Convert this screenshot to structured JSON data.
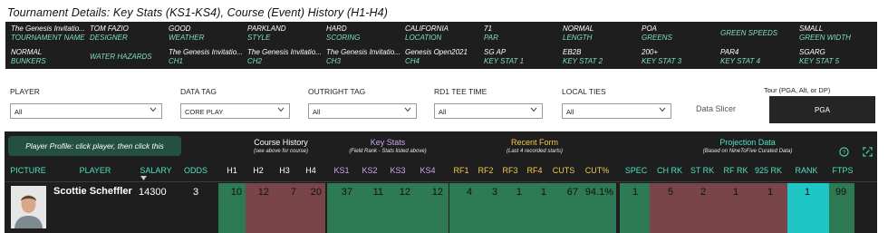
{
  "page_title": "Tournament Details: Key Stats (KS1-KS4), Course (Event) History (H1-H4)",
  "info_grid": [
    {
      "value": "The Genesis Invitatio...",
      "key": "TOURNAMENT NAME"
    },
    {
      "value": "TOM FAZIO",
      "key": "DESIGNER"
    },
    {
      "value": "GOOD",
      "key": "WEATHER"
    },
    {
      "value": "PARKLAND",
      "key": "STYLE"
    },
    {
      "value": "HARD",
      "key": "SCORING"
    },
    {
      "value": "CALIFORNIA",
      "key": "LOCATION"
    },
    {
      "value": "71",
      "key": "PAR"
    },
    {
      "value": "NORMAL",
      "key": "LENGTH"
    },
    {
      "value": "POA",
      "key": "GREENS"
    },
    {
      "value": "",
      "key": "GREEN SPEEDS"
    },
    {
      "value": "SMALL",
      "key": "GREEN WIDTH"
    },
    {
      "value": "NORMAL",
      "key": "BUNKERS"
    },
    {
      "value": "",
      "key": "WATER HAZARDS"
    },
    {
      "value": "The Genesis Invitatio...",
      "key": "CH1"
    },
    {
      "value": "The Genesis Invitatio...",
      "key": "CH2"
    },
    {
      "value": "The Genesis Invitatio...",
      "key": "CH3"
    },
    {
      "value": "Genesis Open2021",
      "key": "CH4"
    },
    {
      "value": "SG AP",
      "key": "KEY STAT 1"
    },
    {
      "value": "EB2B",
      "key": "KEY STAT 2"
    },
    {
      "value": "200+",
      "key": "KEY STAT 3"
    },
    {
      "value": "PAR4",
      "key": "KEY STAT 4"
    },
    {
      "value": "SGARG",
      "key": "KEY STAT 5"
    }
  ],
  "filters": {
    "player": {
      "label": "PLAYER",
      "value": "All"
    },
    "data_tag": {
      "label": "DATA TAG",
      "value": "CORE PLAY"
    },
    "outright_tag": {
      "label": "OUTRIGHT TAG",
      "value": "All"
    },
    "rd1_tee_time": {
      "label": "RD1 TEE TIME",
      "value": "All"
    },
    "local_ties": {
      "label": "LOCAL TIES",
      "value": "All"
    }
  },
  "data_slicer_label": "Data Slicer",
  "tour": {
    "label": "Tour (PGA, Alt, or DP)",
    "value": "PGA"
  },
  "table": {
    "profile_button": "Player Profile: click player, then click this",
    "groups": {
      "course_history": {
        "title": "Course History",
        "sub": "(see above for course)"
      },
      "key_stats": {
        "title": "Key Stats",
        "sub": "(Field Rank - Stats listed above)"
      },
      "recent_form": {
        "title": "Recent Form",
        "sub": "(Last 4 recorded starts)"
      },
      "projection": {
        "title": "Projection Data",
        "sub": "(Based on NineToFive Curated Data)"
      }
    },
    "headers": {
      "picture": "PICTURE",
      "player": "PLAYER",
      "salary": "SALARY",
      "odds": "ODDS",
      "h1": "H1",
      "h2": "H2",
      "h3": "H3",
      "h4": "H4",
      "ks1": "KS1",
      "ks2": "KS2",
      "ks3": "KS3",
      "ks4": "KS4",
      "rf1": "RF1",
      "rf2": "RF2",
      "rf3": "RF3",
      "rf4": "RF4",
      "cuts": "CUTS",
      "cut_pct": "CUT%",
      "spec": "SPEC",
      "ch_rk": "CH RK",
      "st_rk": "ST RK",
      "rf_rk": "RF RK",
      "rk925": "925 RK",
      "rank": "RANK",
      "ftps": "FTPS"
    },
    "row": {
      "player": "Scottie Scheffler",
      "salary": "14300",
      "odds": "3",
      "h1": "10",
      "h2": "12",
      "h3": "7",
      "h4": "20",
      "ks1": "37",
      "ks2": "11",
      "ks3": "12",
      "ks4": "12",
      "rf1": "4",
      "rf2": "3",
      "rf3": "1",
      "rf4": "1",
      "cuts": "67",
      "cut_pct": "94.1%",
      "spec": "1",
      "ch_rk": "5",
      "st_rk": "2",
      "rf_rk": "1",
      "rk925": "1",
      "rank": "1",
      "ftps": "99"
    }
  },
  "colors": {
    "dark_bg": "#1e1e1e",
    "grid_key": "#7fe0c2",
    "good_green": "#2e7a55",
    "bad_red": "#7a4548",
    "rank_cyan": "#1fc6c6",
    "header_teal": "#4fe0bf",
    "header_purple": "#c9a6ea",
    "header_gold": "#f2c94c",
    "button_green": "#23503f"
  }
}
